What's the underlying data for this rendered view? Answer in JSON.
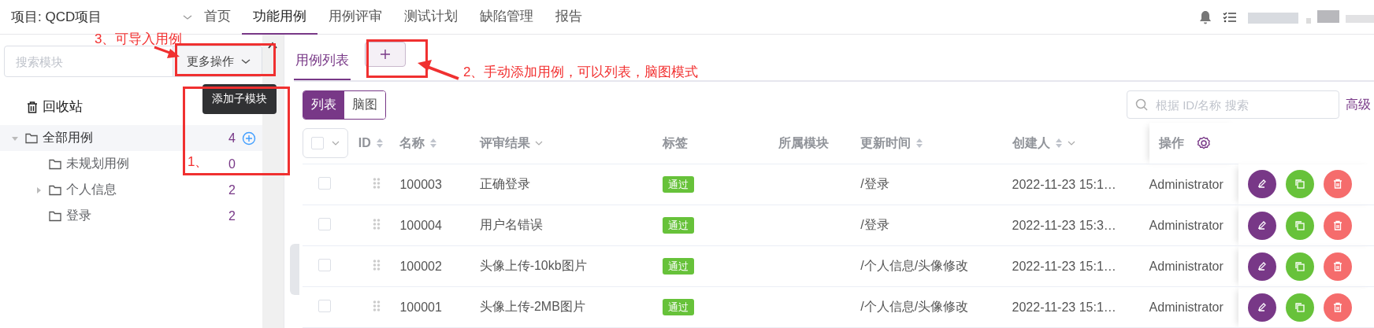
{
  "topbar": {
    "project": "项目: QCD项目",
    "nav": [
      {
        "label": "首页",
        "selected": false
      },
      {
        "label": "功能用例",
        "selected": true
      },
      {
        "label": "用例评审",
        "selected": false
      },
      {
        "label": "测试计划",
        "selected": false
      },
      {
        "label": "缺陷管理",
        "selected": false
      },
      {
        "label": "报告",
        "selected": false
      }
    ]
  },
  "sidebar": {
    "search_placeholder": "搜索模块",
    "more_button": "更多操作",
    "tooltip": "添加子模块",
    "recycle": "回收站",
    "tree": [
      {
        "label": "全部用例",
        "count": "4",
        "selected": true,
        "expanded": true,
        "children": [
          {
            "label": "未规划用例",
            "count": "0",
            "selected": false
          },
          {
            "label": "个人信息",
            "count": "2",
            "selected": false,
            "expanded": false
          },
          {
            "label": "登录",
            "count": "2",
            "selected": false
          }
        ]
      }
    ]
  },
  "tabs": [
    {
      "label": "用例列表",
      "selected": true
    }
  ],
  "view_toggle": [
    {
      "label": "列表",
      "selected": true
    },
    {
      "label": "脑图",
      "selected": false
    }
  ],
  "search": {
    "placeholder": "根据 ID/名称 搜索"
  },
  "advanced_link": "高级",
  "table": {
    "columns": [
      {
        "label": "ID",
        "kind": "sort"
      },
      {
        "label": "名称",
        "kind": "sort"
      },
      {
        "label": "评审结果",
        "kind": "filter"
      },
      {
        "label": "标签",
        "kind": "plain"
      },
      {
        "label": "所属模块",
        "kind": "plain"
      },
      {
        "label": "更新时间",
        "kind": "sort"
      },
      {
        "label": "创建人",
        "kind": "sortfilter"
      },
      {
        "label": "操作",
        "kind": "settings"
      }
    ],
    "rows": [
      {
        "checked": false,
        "id": "100003",
        "name": "正确登录",
        "review": "通过",
        "module": "/登录",
        "updated": "2022-11-23 15:1…",
        "creator": "Administrator"
      },
      {
        "checked": false,
        "id": "100004",
        "name": "用户名错误",
        "review": "通过",
        "module": "/登录",
        "updated": "2022-11-23 15:3…",
        "creator": "Administrator"
      },
      {
        "checked": false,
        "id": "100002",
        "name": "头像上传-10kb图片",
        "review": "通过",
        "module": "/个人信息/头像修改",
        "updated": "2022-11-23 15:1…",
        "creator": "Administrator"
      },
      {
        "checked": false,
        "id": "100001",
        "name": "头像上传-2MB图片",
        "review": "通过",
        "module": "/个人信息/头像修改",
        "updated": "2022-11-23 15:1…",
        "creator": "Administrator"
      }
    ]
  },
  "annotations": [
    {
      "text": "3、可导入用例"
    },
    {
      "text": "2、手动添加用例，可以列表，脑图模式"
    },
    {
      "text": "1、"
    }
  ]
}
